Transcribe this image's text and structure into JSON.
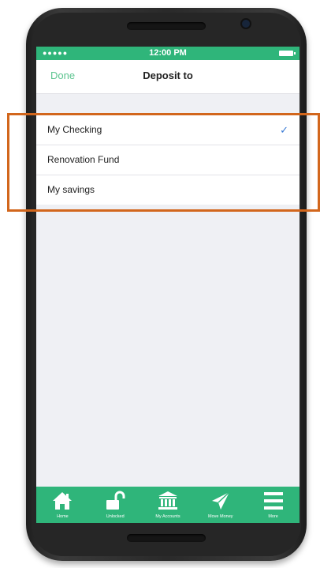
{
  "status_bar": {
    "signal": "●●●●●",
    "time": "12:00 PM"
  },
  "nav": {
    "done_label": "Done",
    "title": "Deposit to"
  },
  "accounts": [
    {
      "name": "My Checking",
      "selected": true
    },
    {
      "name": "Renovation Fund",
      "selected": false
    },
    {
      "name": "My savings",
      "selected": false
    }
  ],
  "selected_mark": "✓",
  "tabs": [
    {
      "label": "Home",
      "icon": "home-icon"
    },
    {
      "label": "Unlocked",
      "icon": "unlocked-icon"
    },
    {
      "label": "My Accounts",
      "icon": "bank-icon"
    },
    {
      "label": "Move Money",
      "icon": "send-icon"
    },
    {
      "label": "More",
      "icon": "menu-icon"
    }
  ],
  "colors": {
    "brand_green": "#2fb57a",
    "done_green": "#5cc48f",
    "check_blue": "#3a7bd5",
    "highlight_orange": "#d2661c"
  }
}
